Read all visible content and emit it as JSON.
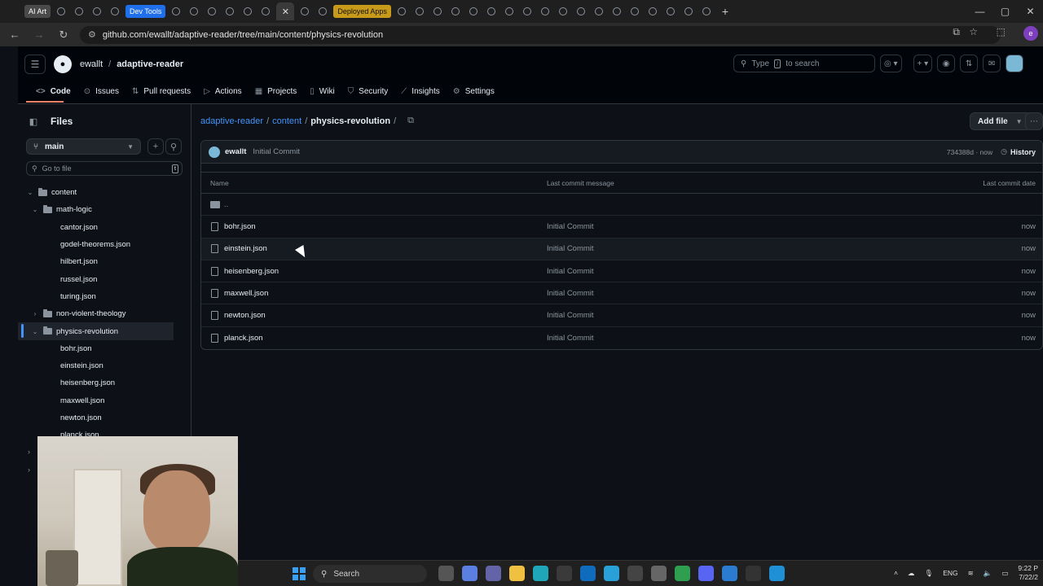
{
  "browser": {
    "tab_chips": [
      {
        "label": "AI Art",
        "color": "#4a4a4a"
      },
      {
        "label": "Dev Tools",
        "color": "#1f6feb"
      },
      {
        "label": "Deployed Apps",
        "color": "#c89a1a"
      }
    ],
    "url": "github.com/ewallt/adaptive-reader/tree/main/content/physics-revolution"
  },
  "header": {
    "owner": "ewallt",
    "repo": "adaptive-reader",
    "search_placeholder_pre": "Type",
    "search_key": "/",
    "search_placeholder_post": "to search"
  },
  "repo_nav": [
    {
      "label": "Code",
      "icon": "code-icon"
    },
    {
      "label": "Issues",
      "icon": "issue-icon"
    },
    {
      "label": "Pull requests",
      "icon": "pull-request-icon"
    },
    {
      "label": "Actions",
      "icon": "actions-icon"
    },
    {
      "label": "Projects",
      "icon": "projects-icon"
    },
    {
      "label": "Wiki",
      "icon": "wiki-icon"
    },
    {
      "label": "Security",
      "icon": "shield-icon"
    },
    {
      "label": "Insights",
      "icon": "graph-icon"
    },
    {
      "label": "Settings",
      "icon": "gear-icon"
    }
  ],
  "sidebar": {
    "title": "Files",
    "branch": "main",
    "goto_placeholder": "Go to file",
    "goto_key": "t",
    "tree": [
      {
        "label": "content",
        "type": "folder",
        "depth": 0,
        "expanded": true
      },
      {
        "label": "math-logic",
        "type": "folder",
        "depth": 1,
        "expanded": true
      },
      {
        "label": "cantor.json",
        "type": "file",
        "depth": 2
      },
      {
        "label": "godel-theorems.json",
        "type": "file",
        "depth": 2
      },
      {
        "label": "hilbert.json",
        "type": "file",
        "depth": 2
      },
      {
        "label": "russel.json",
        "type": "file",
        "depth": 2
      },
      {
        "label": "turing.json",
        "type": "file",
        "depth": 2
      },
      {
        "label": "non-violent-theology",
        "type": "folder",
        "depth": 1,
        "expanded": false
      },
      {
        "label": "physics-revolution",
        "type": "folder",
        "depth": 1,
        "expanded": true,
        "selected": true
      },
      {
        "label": "bohr.json",
        "type": "file",
        "depth": 2
      },
      {
        "label": "einstein.json",
        "type": "file",
        "depth": 2
      },
      {
        "label": "heisenberg.json",
        "type": "file",
        "depth": 2
      },
      {
        "label": "maxwell.json",
        "type": "file",
        "depth": 2
      },
      {
        "label": "newton.json",
        "type": "file",
        "depth": 2
      },
      {
        "label": "planck.json",
        "type": "file",
        "depth": 2
      }
    ]
  },
  "main": {
    "path": [
      "adaptive-reader",
      "content",
      "physics-revolution"
    ],
    "add_file_label": "Add file",
    "commit": {
      "author": "ewallt",
      "message": "Initial Commit",
      "sha_time": "734388d · now",
      "history_label": "History"
    },
    "columns": {
      "name": "Name",
      "message": "Last commit message",
      "date": "Last commit date"
    },
    "parent_dir": "..",
    "files": [
      {
        "name": "bohr.json",
        "message": "Initial Commit",
        "date": "now"
      },
      {
        "name": "einstein.json",
        "message": "Initial Commit",
        "date": "now"
      },
      {
        "name": "heisenberg.json",
        "message": "Initial Commit",
        "date": "now"
      },
      {
        "name": "maxwell.json",
        "message": "Initial Commit",
        "date": "now"
      },
      {
        "name": "newton.json",
        "message": "Initial Commit",
        "date": "now"
      },
      {
        "name": "planck.json",
        "message": "Initial Commit",
        "date": "now"
      }
    ]
  },
  "taskbar": {
    "search_label": "Search",
    "language": "ENG",
    "time": "9:22 P",
    "date": "7/22/2"
  },
  "colors": {
    "link": "#4493f8",
    "accent_underline": "#f78166",
    "bg": "#0d1117"
  }
}
